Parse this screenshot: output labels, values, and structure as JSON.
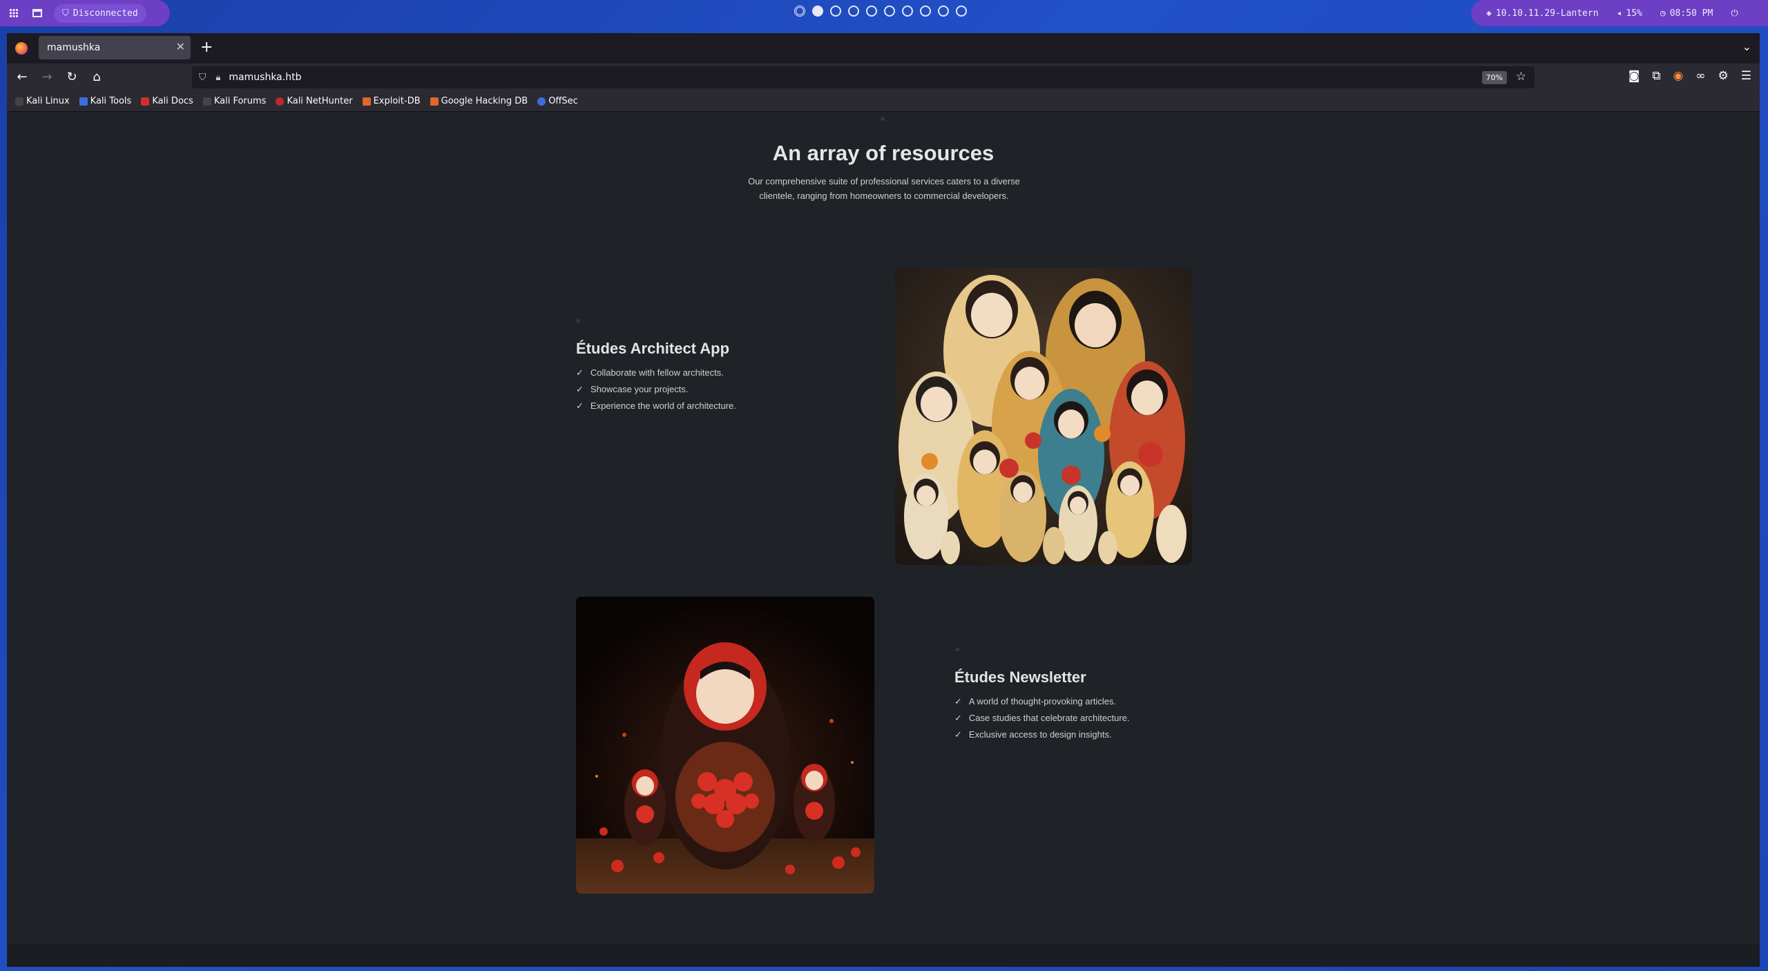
{
  "desktop": {
    "status_disconnected": "Disconnected",
    "vpn_target": "10.10.11.29-Lantern",
    "volume": "15%",
    "clock": "08:50 PM",
    "workspaces": 10,
    "active_workspace": 2
  },
  "browser": {
    "tab_title": "mamushka",
    "url": "mamushka.htb",
    "zoom": "70%",
    "bookmarks": [
      {
        "label": "Kali Linux",
        "color": "#333"
      },
      {
        "label": "Kali Tools",
        "color": "#3d6fd8"
      },
      {
        "label": "Kali Docs",
        "color": "#d62b2b"
      },
      {
        "label": "Kali Forums",
        "color": "#333"
      },
      {
        "label": "Kali NetHunter",
        "color": "#c0282d"
      },
      {
        "label": "Exploit-DB",
        "color": "#e0662a"
      },
      {
        "label": "Google Hacking DB",
        "color": "#e0662a"
      },
      {
        "label": "OffSec",
        "color": "#3b6fd8"
      }
    ]
  },
  "page": {
    "section_title": "An array of resources",
    "section_subtitle": "Our comprehensive suite of professional services caters to a diverse clientele, ranging from homeowners to commercial developers.",
    "features": [
      {
        "title": "Études Architect App",
        "items": [
          "Collaborate with fellow architects.",
          "Showcase your projects.",
          "Experience the world of architecture."
        ]
      },
      {
        "title": "Études Newsletter",
        "items": [
          "A world of thought-provoking articles.",
          "Case studies that celebrate architecture.",
          "Exclusive access to design insights."
        ]
      }
    ],
    "check_glyph": "✓"
  }
}
